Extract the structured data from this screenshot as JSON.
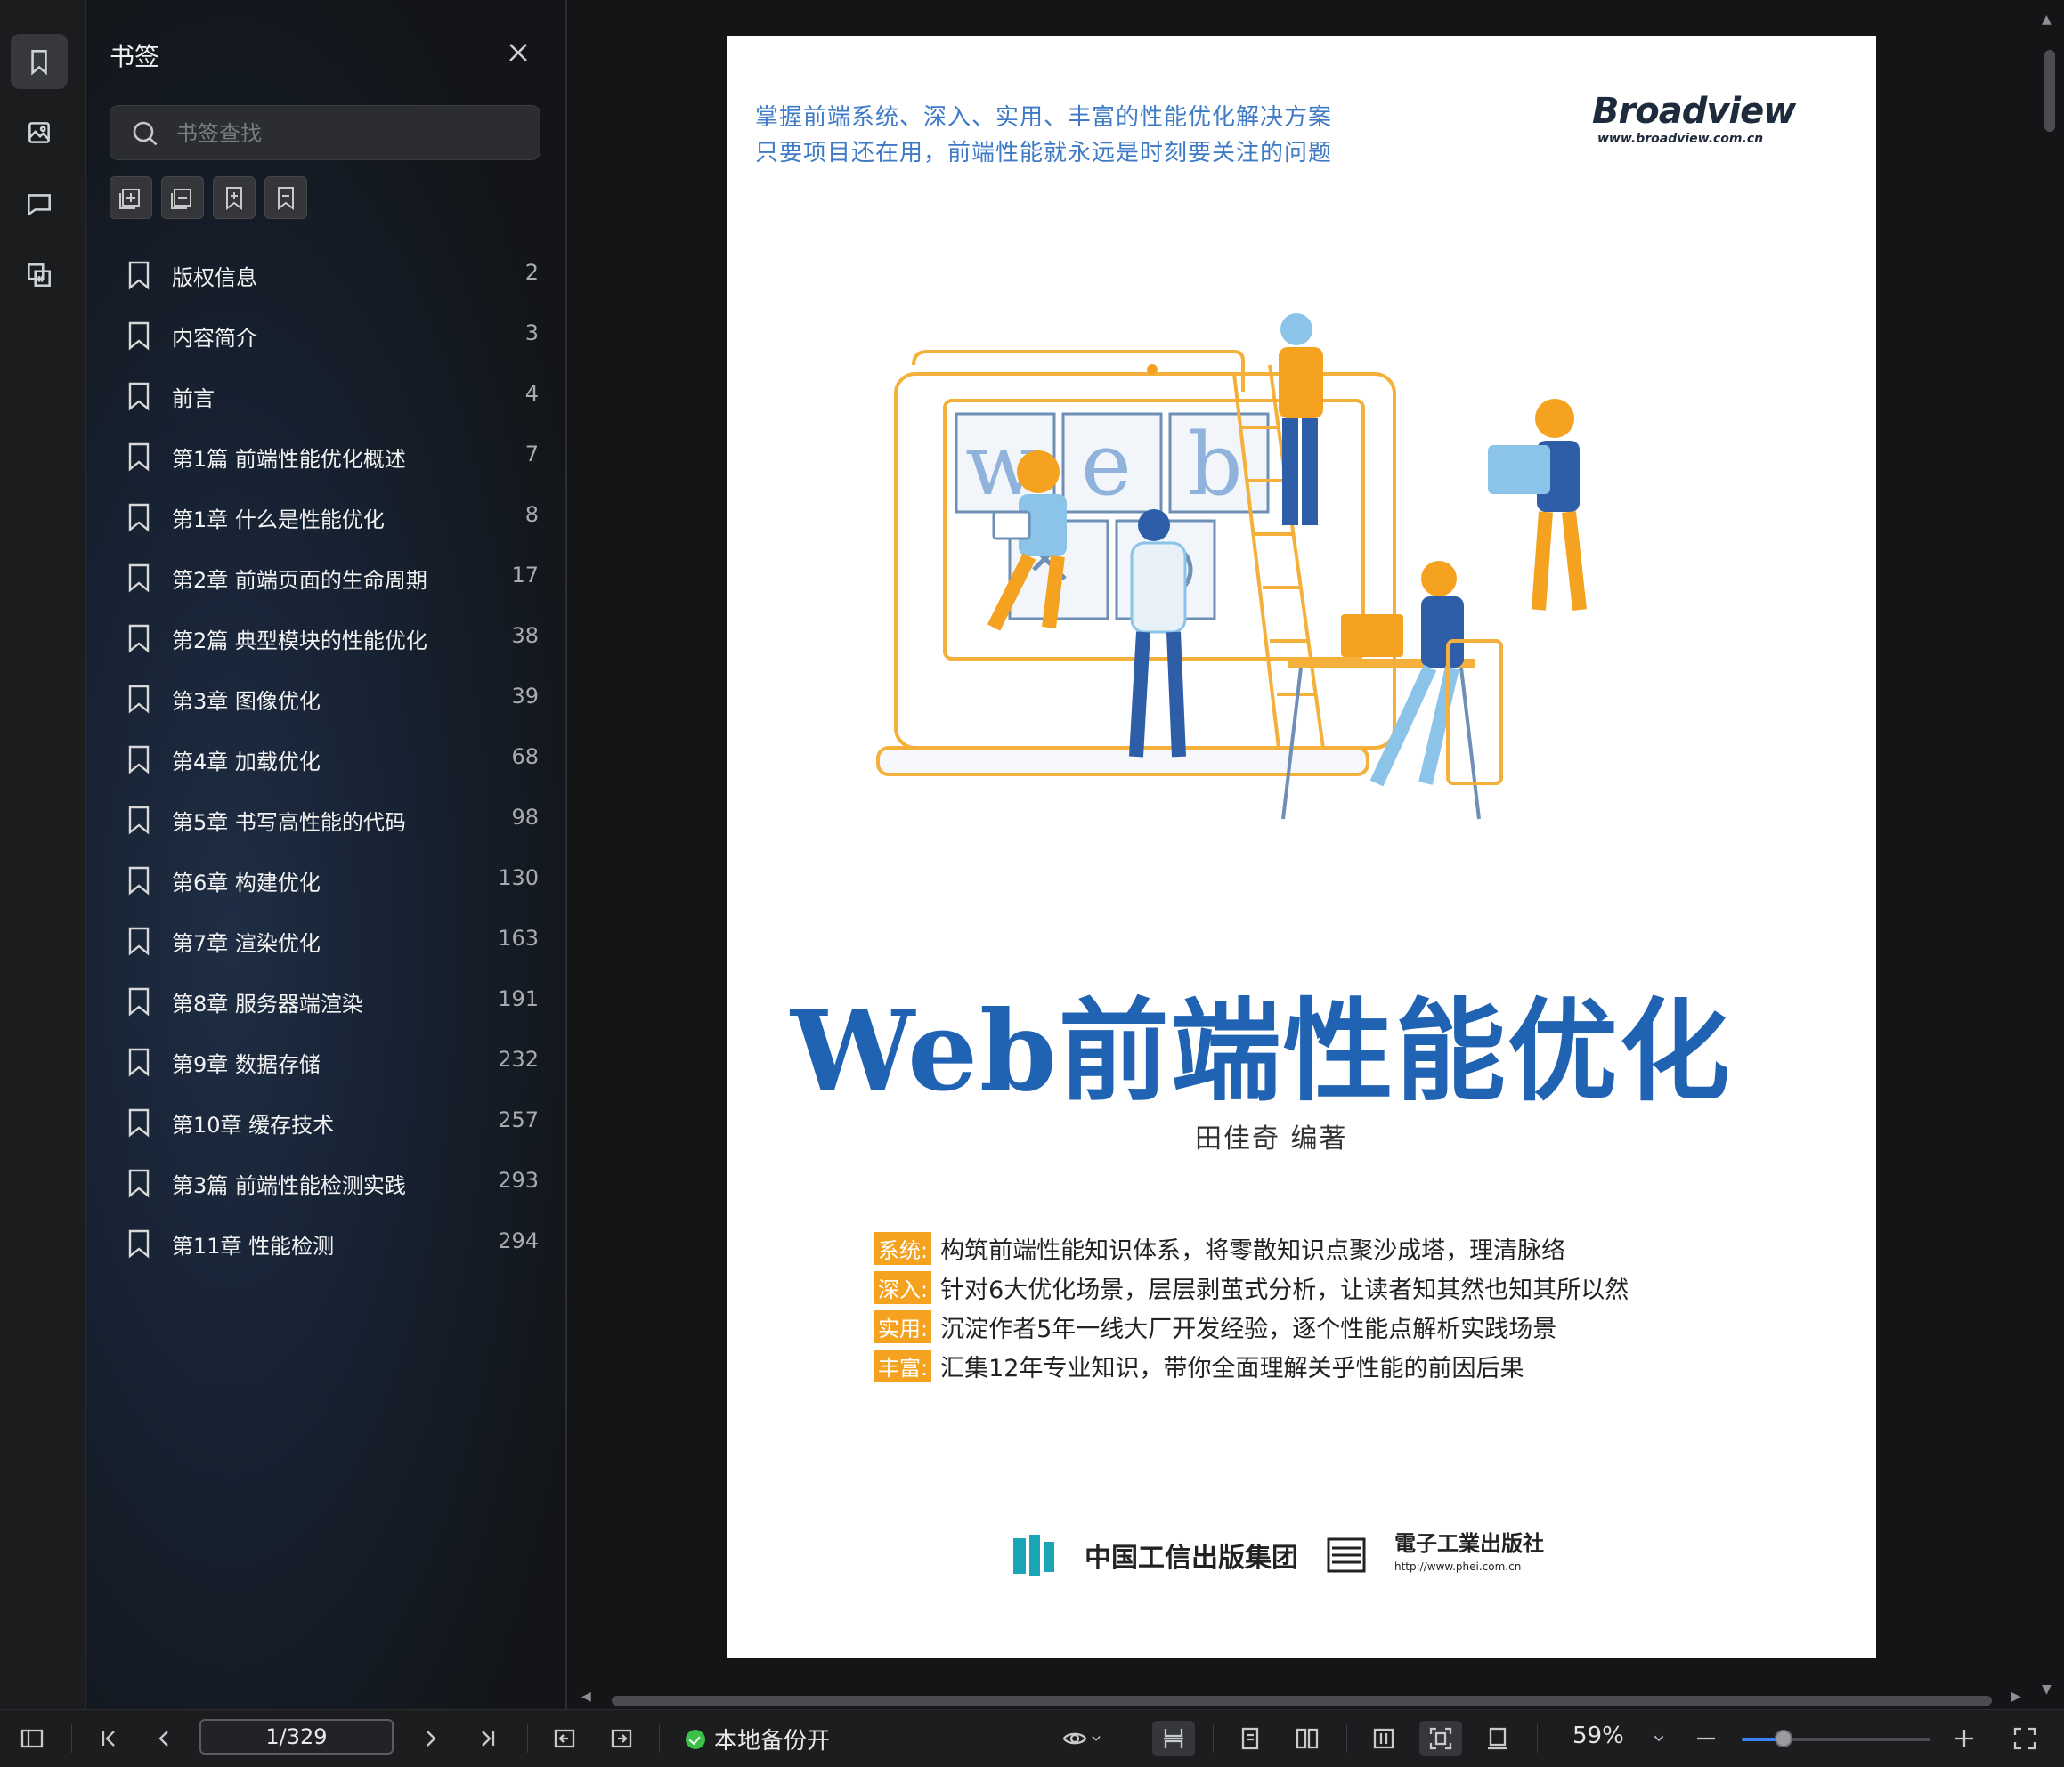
{
  "sidebar_rail": {
    "items": [
      {
        "icon": "bookmark-icon",
        "active": true
      },
      {
        "icon": "image-icon",
        "active": false
      },
      {
        "icon": "comment-icon",
        "active": false
      },
      {
        "icon": "layers-icon",
        "active": false
      }
    ]
  },
  "bookmark_panel": {
    "title": "书签",
    "search_placeholder": "书签查找",
    "tools": [
      "expand-all-icon",
      "collapse-all-icon",
      "add-bookmark-icon",
      "remove-bookmark-icon"
    ],
    "items": [
      {
        "label": "版权信息",
        "page": "2"
      },
      {
        "label": "内容简介",
        "page": "3"
      },
      {
        "label": "前言",
        "page": "4"
      },
      {
        "label": "第1篇 前端性能优化概述",
        "page": "7"
      },
      {
        "label": "第1章 什么是性能优化",
        "page": "8"
      },
      {
        "label": "第2章 前端页面的生命周期",
        "page": "17"
      },
      {
        "label": "第2篇 典型模块的性能优化",
        "page": "38"
      },
      {
        "label": "第3章 图像优化",
        "page": "39"
      },
      {
        "label": "第4章 加载优化",
        "page": "68"
      },
      {
        "label": "第5章 书写高性能的代码",
        "page": "98"
      },
      {
        "label": "第6章 构建优化",
        "page": "130"
      },
      {
        "label": "第7章 渲染优化",
        "page": "163"
      },
      {
        "label": "第8章 服务器端渲染",
        "page": "191"
      },
      {
        "label": "第9章 数据存储",
        "page": "232"
      },
      {
        "label": "第10章 缓存技术",
        "page": "257"
      },
      {
        "label": "第3篇 前端性能检测实践",
        "page": "293"
      },
      {
        "label": "第11章 性能检测",
        "page": "294"
      }
    ]
  },
  "document": {
    "tagline_1": "掌握前端系统、深入、实用、丰富的性能优化解决方案",
    "tagline_2": "只要项目还在用，前端性能就永远是时刻要关注的问题",
    "publisher_brand": "Broadview",
    "publisher_url": "www.broadview.com.cn",
    "illustration_words": [
      "w",
      "e",
      "b"
    ],
    "title": "Web前端性能优化",
    "author": "田佳奇  编著",
    "features": [
      {
        "tag": "系统:",
        "text": "构筑前端性能知识体系，将零散知识点聚沙成塔，理清脉络"
      },
      {
        "tag": "深入:",
        "text": "针对6大优化场景，层层剥茧式分析，让读者知其然也知其所以然"
      },
      {
        "tag": "实用:",
        "text": "沉淀作者5年一线大厂开发经验，逐个性能点解析实践场景"
      },
      {
        "tag": "丰富:",
        "text": "汇集12年专业知识，带你全面理解关乎性能的前因后果"
      }
    ],
    "footer_group": "中国工信出版集团",
    "footer_phei": "電子工業出版社",
    "footer_phei_url": "http://www.phei.com.cn"
  },
  "toolbar": {
    "page_value": "1/329",
    "backup_label": "本地备份开",
    "zoom": "59%",
    "zoom_fraction": 0.22,
    "colors": {
      "accent": "#3b82f6",
      "backup_status": "#3cc04a",
      "title_blue": "#2163b3",
      "tag_orange": "#f4a21f"
    }
  }
}
